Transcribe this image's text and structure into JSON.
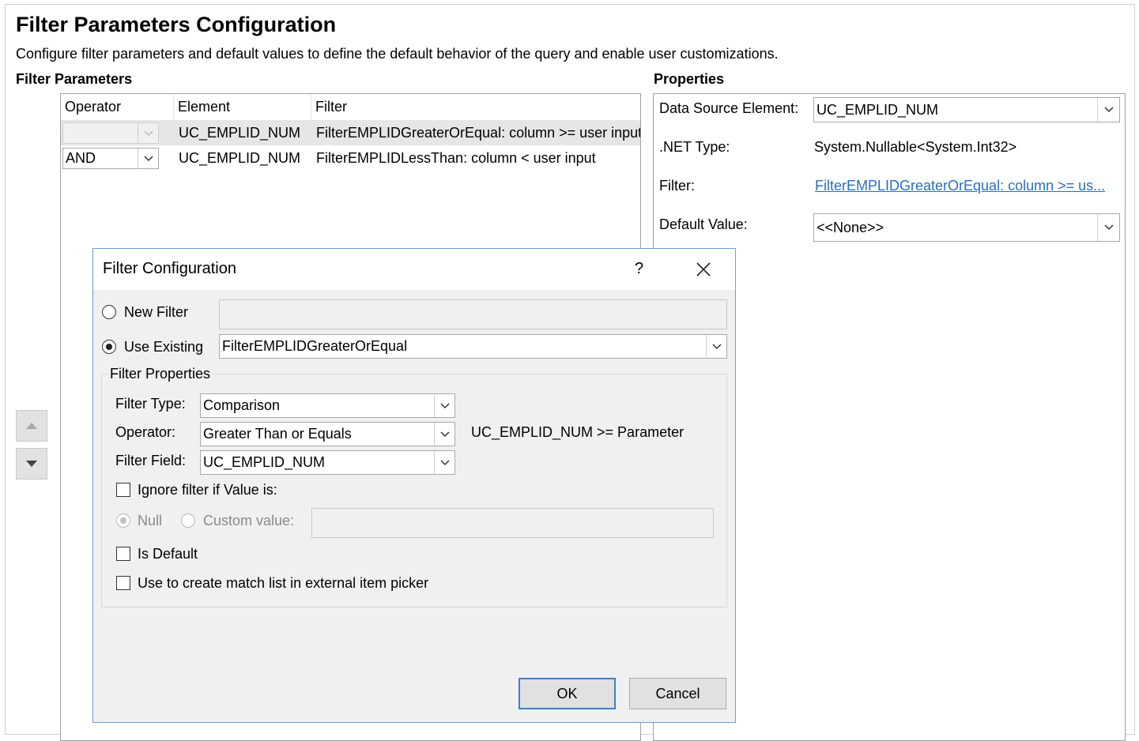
{
  "page": {
    "title": "Filter Parameters Configuration",
    "description": "Configure filter parameters and default values to define the default behavior of the query and enable user customizations."
  },
  "filter_parameters": {
    "section_title": "Filter Parameters",
    "columns": [
      "Operator",
      "Element",
      "Filter"
    ],
    "rows": [
      {
        "operator": "",
        "element": "UC_EMPLID_NUM",
        "filter": "FilterEMPLIDGreaterOrEqual: column >= user input"
      },
      {
        "operator": "AND",
        "element": "UC_EMPLID_NUM",
        "filter": "FilterEMPLIDLessThan: column < user input"
      }
    ]
  },
  "properties": {
    "section_title": "Properties",
    "data_source_label": "Data Source Element:",
    "data_source_value": "UC_EMPLID_NUM",
    "net_type_label": ".NET Type:",
    "net_type_value": "System.Nullable<System.Int32>",
    "filter_label": "Filter:",
    "filter_value": "FilterEMPLIDGreaterOrEqual: column >= us...",
    "default_value_label": "Default Value:",
    "default_value_value": "<<None>>"
  },
  "dialog": {
    "title": "Filter Configuration",
    "help": "?",
    "new_filter_label": "New Filter",
    "new_filter_value": "",
    "use_existing_label": "Use Existing",
    "use_existing_value": "FilterEMPLIDGreaterOrEqual",
    "group_title": "Filter Properties",
    "filter_type_label": "Filter Type:",
    "filter_type_value": "Comparison",
    "operator_label": "Operator:",
    "operator_value": "Greater Than or Equals",
    "operator_expression": "UC_EMPLID_NUM >= Parameter",
    "filter_field_label": "Filter Field:",
    "filter_field_value": "UC_EMPLID_NUM",
    "ignore_label": "Ignore filter if Value is:",
    "null_label": "Null",
    "custom_value_label": "Custom value:",
    "custom_value_value": "",
    "is_default_label": "Is Default",
    "match_list_label": "Use to create match list in external item picker",
    "ok_label": "OK",
    "cancel_label": "Cancel"
  },
  "icons": {
    "combo": "chevron-down-icon",
    "move_up": "triangle-up-icon",
    "move_down": "triangle-down-icon",
    "close": "close-icon"
  },
  "colors": {
    "link": "#2a6ebb",
    "dialog_border": "#6c9fd4",
    "selected_row": "#e6e6e6",
    "default_button_border": "#3c7fd1"
  }
}
